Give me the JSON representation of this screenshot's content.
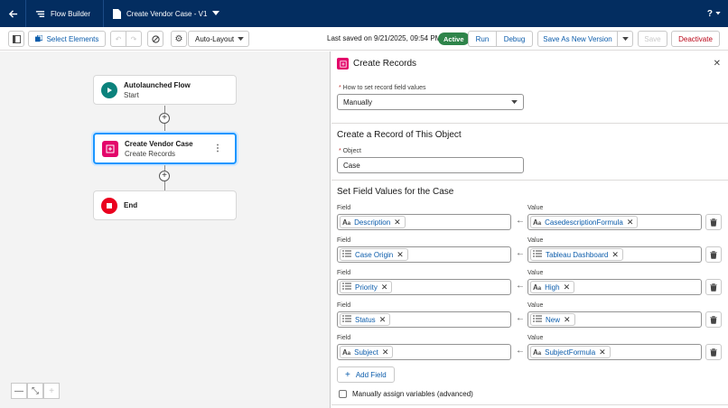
{
  "header": {
    "app_name": "Flow Builder",
    "flow_tab": "Create Vendor Case - V1",
    "help_label": "?"
  },
  "toolbar": {
    "select_elements": "Select Elements",
    "layout": "Auto-Layout",
    "last_saved": "Last saved on 9/21/2025, 09:54 PM",
    "status": "Active",
    "run": "Run",
    "debug": "Debug",
    "save_as": "Save As New Version",
    "save": "Save",
    "deactivate": "Deactivate"
  },
  "canvas": {
    "nodes": [
      {
        "title": "Autolaunched Flow",
        "subtitle": "Start"
      },
      {
        "title": "Create Vendor Case",
        "subtitle": "Create Records"
      },
      {
        "title": "End",
        "subtitle": ""
      }
    ],
    "add_symbol": "+",
    "zoom": {
      "out": "—",
      "fit": "⤡",
      "in": "+"
    }
  },
  "panel": {
    "title": "Create Records",
    "how_label": "How to set record field values",
    "how_value": "Manually",
    "section1": "Create a Record of This Object",
    "object_label": "Object",
    "object_value": "Case",
    "section2": "Set Field Values for the Case",
    "field_label": "Field",
    "value_label": "Value",
    "rows": [
      {
        "field": "Description",
        "value": "CasedescriptionFormula"
      },
      {
        "field": "Case Origin",
        "value": "Tableau Dashboard"
      },
      {
        "field": "Priority",
        "value": "High"
      },
      {
        "field": "Status",
        "value": "New"
      },
      {
        "field": "Subject",
        "value": "SubjectFormula"
      }
    ],
    "add_field": "Add Field",
    "manual_assign": "Manually assign variables (advanced)"
  },
  "colors": {
    "header_bg": "#032d60",
    "active_badge": "#2e844a",
    "brand_blue": "#0b5cab",
    "create_records_pink": "#e3066a",
    "start_teal": "#0b827c",
    "end_red": "#ea001e"
  }
}
